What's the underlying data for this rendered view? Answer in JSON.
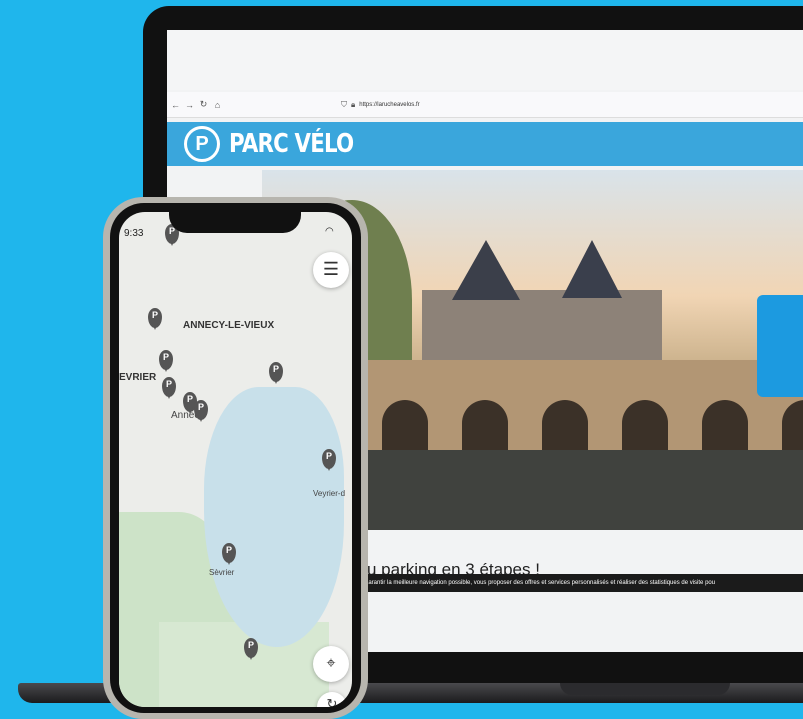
{
  "browser": {
    "url": "https://larucheavelos.fr",
    "back_icon": "arrow-left-icon",
    "forward_icon": "arrow-right-icon",
    "reload_icon": "reload-icon",
    "home_icon": "home-icon"
  },
  "site": {
    "logo_letter": "P",
    "name": "PARC VÉLO",
    "section_title": "u parking en 3 étapes !",
    "cookie_text": "garantir la meilleure navigation possible, vous proposer des offres et services personnalisés et réaliser des statistiques de visite pou",
    "brand_color": "#3aa6dc"
  },
  "phone": {
    "time": "9:33",
    "map_labels": {
      "annecy_le_vieux": "ANNECY-LE-VIEUX",
      "seynod": "EVRIER",
      "annecy": "Annecy",
      "veyrier": "Veyrier-d",
      "sevrier": "Sèvrier"
    },
    "pin_letter": "P",
    "menu_icon": "hamburger-icon",
    "locate_icon": "locate-icon",
    "refresh_icon": "refresh-icon"
  }
}
